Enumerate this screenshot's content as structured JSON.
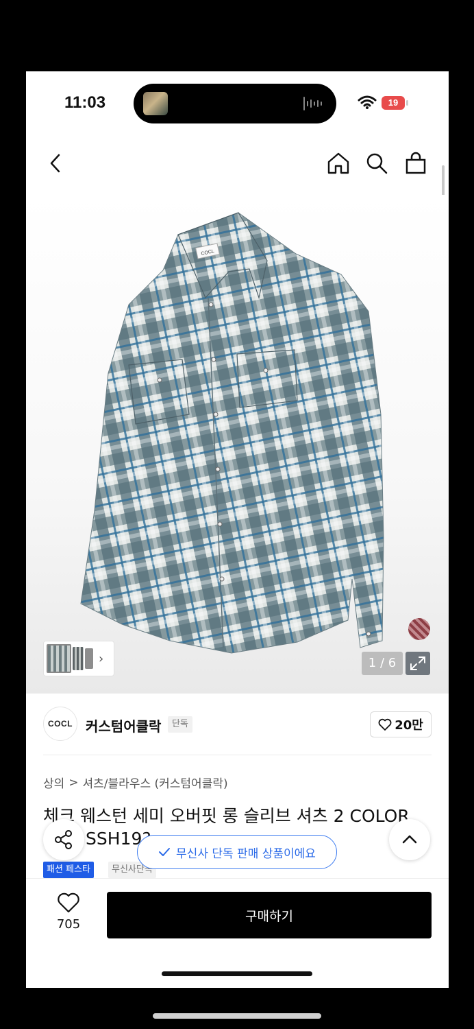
{
  "status": {
    "time": "11:03",
    "battery": "19"
  },
  "nav": {
    "back_icon": "chevron-left-icon",
    "home_icon": "home-icon",
    "search_icon": "search-icon",
    "cart_icon": "shopping-bag-icon"
  },
  "image": {
    "counter": "1 / 6",
    "label_text": "COCL"
  },
  "brand": {
    "logo_text": "COCL",
    "name": "커스텀어클락",
    "badge": "단독",
    "likes": "20만"
  },
  "breadcrumb": {
    "level1": "상의",
    "separator": ">",
    "level2": "셔츠/블라우스 (커스텀어클락)"
  },
  "product": {
    "title_line1": "체크 웨스턴 세미 오버핏 롱 슬리브 셔츠 2 COLOR",
    "title_line2": "SSH19?"
  },
  "toast": {
    "text": "무신사 단독 판매 상품이에요"
  },
  "tags": {
    "fashion": "패션 페스타",
    "exclusive": "무신사단독"
  },
  "bottom": {
    "wish_count": "705",
    "buy_label": "구매하기"
  },
  "colors": {
    "buy_button": "#000000",
    "toast_accent": "#2a6ae8",
    "tag_blue": "#1f5ce6",
    "battery": "#e84b4b"
  }
}
